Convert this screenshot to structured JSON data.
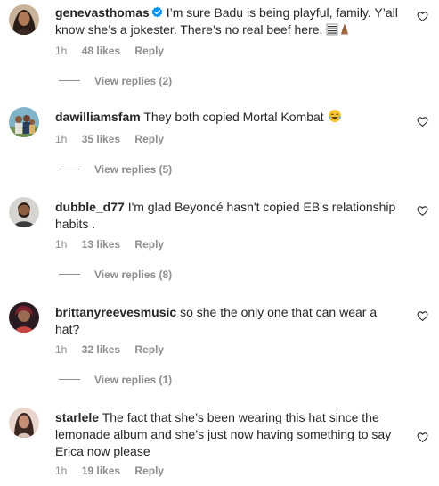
{
  "comments": [
    {
      "username": "genevasthomas",
      "verified": true,
      "text": "I’m sure Badu is being playful, family. Y’all know she’s a jokester. There’s no real beef here.",
      "time": "1h",
      "likes": "48 likes",
      "reply": "Reply",
      "view_replies": "View replies (2)"
    },
    {
      "username": "dawilliamsfam",
      "verified": false,
      "text": "They both copied Mortal Kombat",
      "time": "1h",
      "likes": "35 likes",
      "reply": "Reply",
      "view_replies": "View replies (5)"
    },
    {
      "username": "dubble_d77",
      "verified": false,
      "text": "I'm glad Beyoncé hasn't copied EB's relationship habits .",
      "time": "1h",
      "likes": "13 likes",
      "reply": "Reply",
      "view_replies": "View replies (8)"
    },
    {
      "username": "brittanyreevesmusic",
      "verified": false,
      "text": "so she the only one that can wear a hat?",
      "time": "1h",
      "likes": "32 likes",
      "reply": "Reply",
      "view_replies": "View replies (1)"
    },
    {
      "username": "starlele",
      "verified": false,
      "text": "The fact that she’s been wearing this hat since the lemonade album and she’s just now having something to say Erica now please",
      "time": "1h",
      "likes": "19 likes",
      "reply": "Reply"
    }
  ],
  "colors": {
    "text": "#262626",
    "secondary": "#8e8e8e",
    "verified_blue": "#0095f6"
  },
  "icons": {
    "heart": "heart-outline-icon",
    "verified": "verified-badge-icon",
    "emoji_1": "abacus-emoji",
    "emoji_2": "praying-hands-emoji",
    "emoji_3": "tears-of-joy-emoji"
  }
}
